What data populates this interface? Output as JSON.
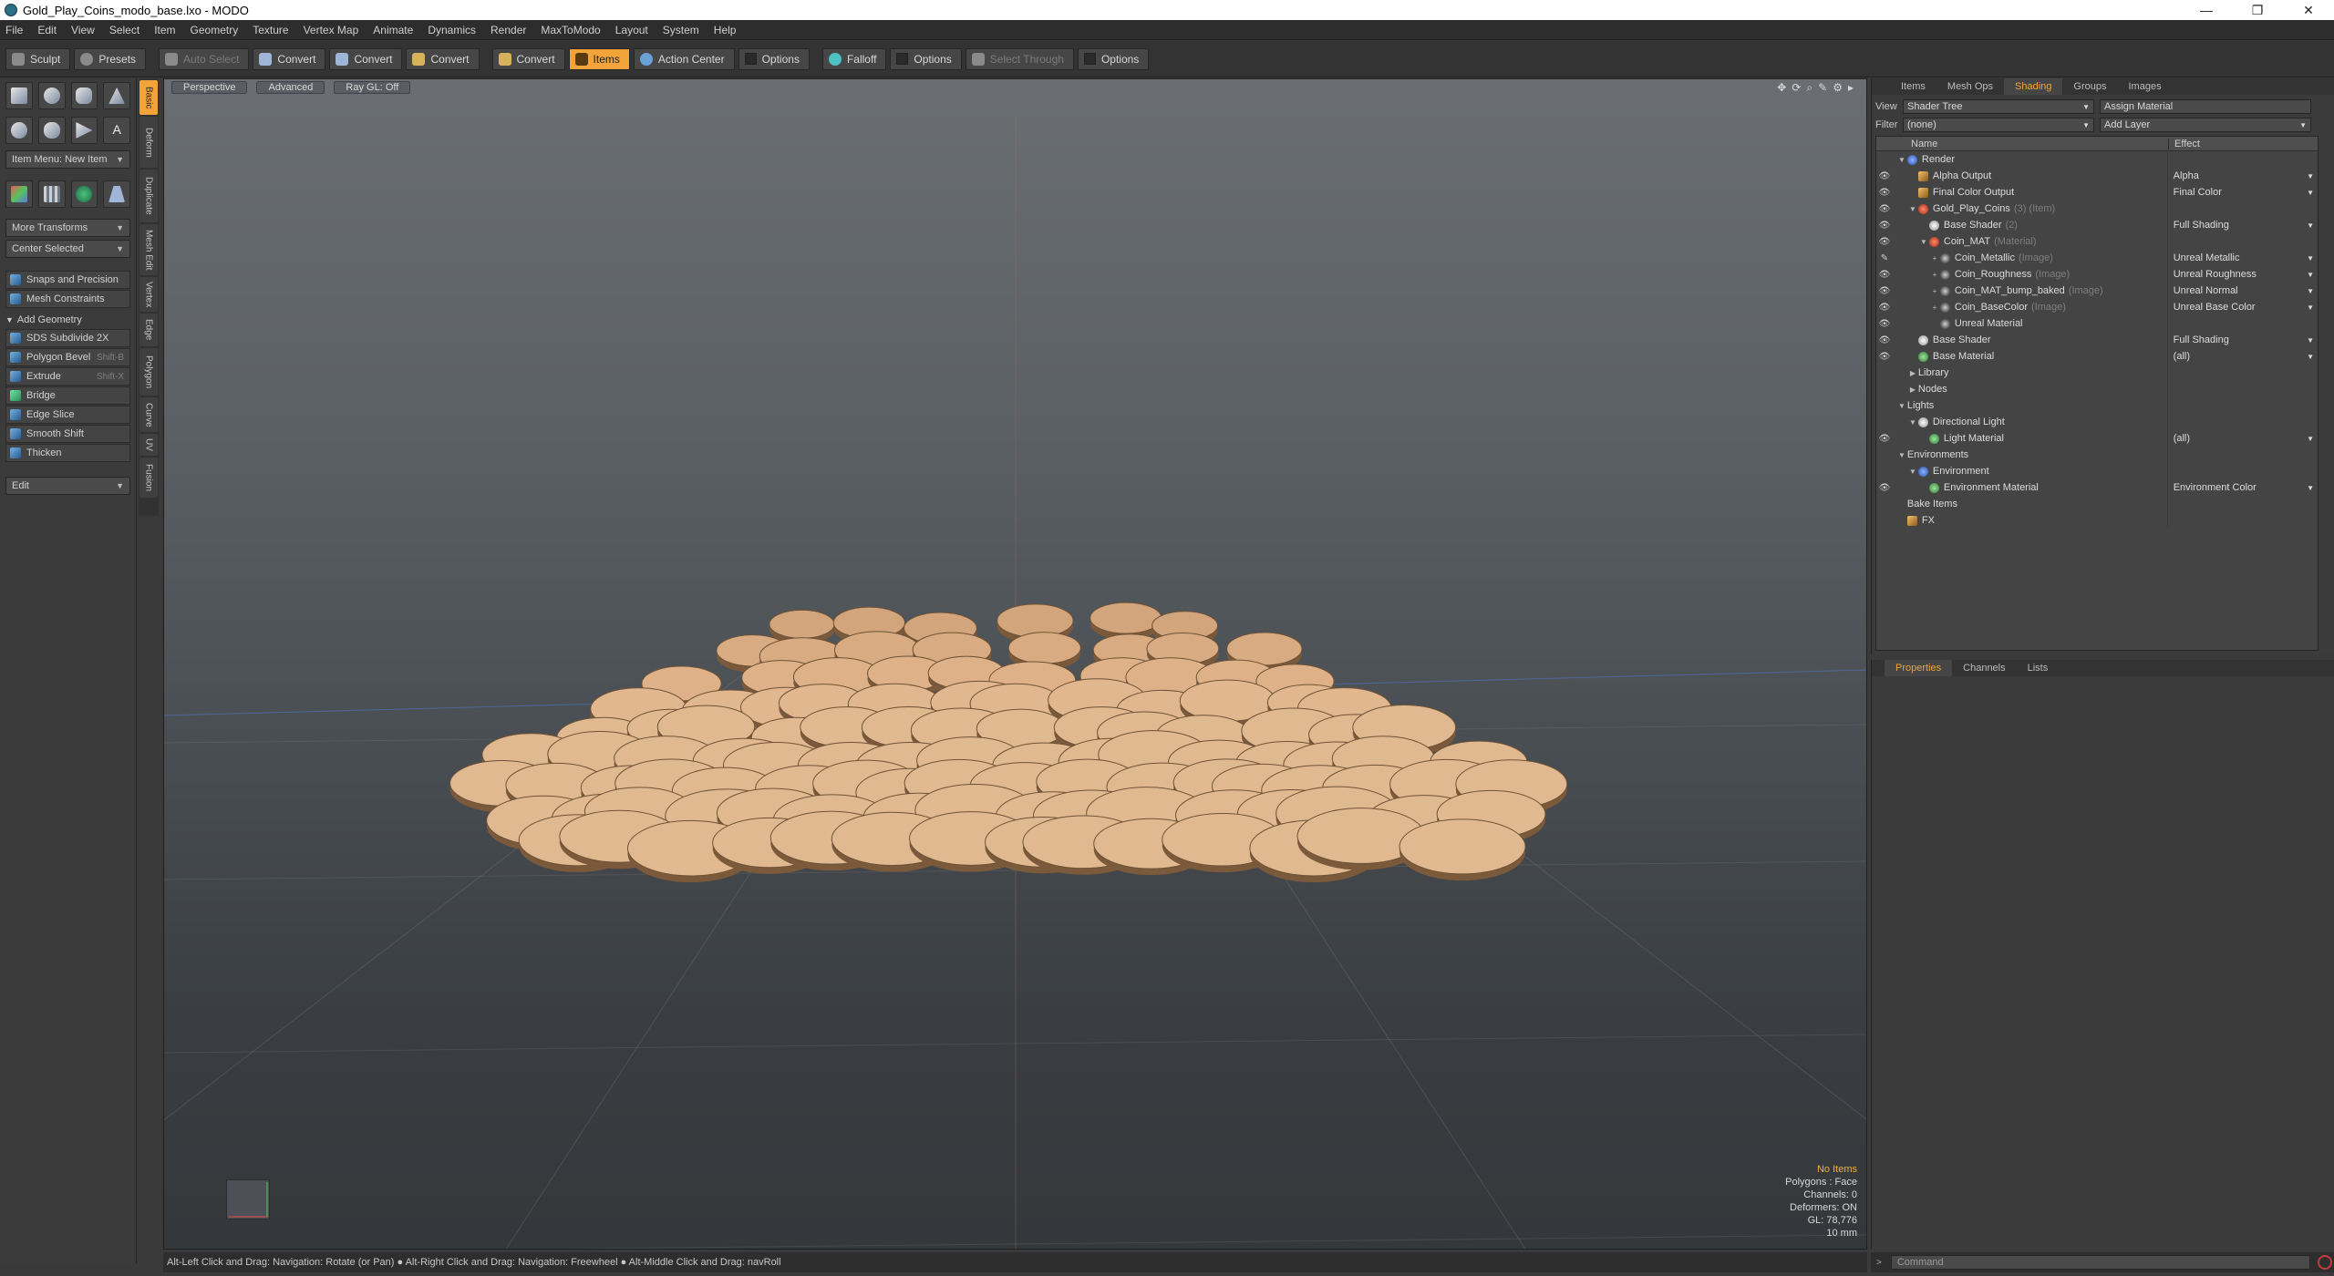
{
  "window": {
    "title": "Gold_Play_Coins_modo_base.lxo - MODO"
  },
  "menu": [
    "File",
    "Edit",
    "View",
    "Select",
    "Item",
    "Geometry",
    "Texture",
    "Vertex Map",
    "Animate",
    "Dynamics",
    "Render",
    "MaxToModo",
    "Layout",
    "System",
    "Help"
  ],
  "toolbar": {
    "sculpt": "Sculpt",
    "presets": "Presets",
    "auto_select": "Auto Select",
    "convert1": "Convert",
    "convert2": "Convert",
    "convert3": "Convert",
    "convert4": "Convert",
    "items": "Items",
    "action_center": "Action Center",
    "options1": "Options",
    "falloff": "Falloff",
    "options2": "Options",
    "select_through": "Select Through",
    "options3": "Options"
  },
  "left": {
    "item_menu": "Item Menu: New Item",
    "more_transforms": "More Transforms",
    "center_selected": "Center Selected",
    "snaps": "Snaps and Precision",
    "mesh_constraints": "Mesh Constraints",
    "add_geometry": "Add Geometry",
    "sds": "SDS Subdivide 2X",
    "polygon_bevel": "Polygon Bevel",
    "polygon_bevel_sc": "Shift-B",
    "extrude": "Extrude",
    "extrude_sc": "Shift-X",
    "bridge": "Bridge",
    "edge_slice": "Edge Slice",
    "smooth_shift": "Smooth Shift",
    "thicken": "Thicken",
    "edit": "Edit"
  },
  "vtabs": [
    "Basic",
    "Deform",
    "Duplicate",
    "Mesh Edit",
    "Vertex",
    "Edge",
    "Polygon",
    "Curve",
    "UV",
    "Fusion"
  ],
  "viewport": {
    "tabs": [
      "Perspective",
      "Advanced",
      "Ray GL: Off"
    ],
    "info": {
      "no_items": "No Items",
      "polygons": "Polygons : Face",
      "channels": "Channels: 0",
      "deformers": "Deformers: ON",
      "gl": "GL: 78,776",
      "scale": "10 mm"
    }
  },
  "status": "Alt-Left Click and Drag: Navigation: Rotate (or Pan) ● Alt-Right Click and Drag: Navigation: Freewheel ● Alt-Middle Click and Drag: navRoll",
  "right": {
    "tabs": [
      "Items",
      "Mesh Ops",
      "Shading",
      "Groups",
      "Images"
    ],
    "view_label": "View",
    "view_value": "Shader Tree",
    "assign_material": "Assign Material",
    "filter_label": "Filter",
    "filter_value": "(none)",
    "add_layer": "Add Layer",
    "col_name": "Name",
    "col_effect": "Effect",
    "tree": [
      {
        "indent": 0,
        "tri": "▼",
        "icon": "blue",
        "name": "Render",
        "tag": "",
        "effect": "",
        "eye": ""
      },
      {
        "indent": 1,
        "tri": "",
        "icon": "sq",
        "name": "Alpha Output",
        "tag": "",
        "effect": "Alpha",
        "eye": "👁"
      },
      {
        "indent": 1,
        "tri": "",
        "icon": "sq",
        "name": "Final Color Output",
        "tag": "",
        "effect": "Final Color",
        "eye": "👁"
      },
      {
        "indent": 1,
        "tri": "▼",
        "icon": "red",
        "name": "Gold_Play_Coins",
        "tag": "(3) (Item)",
        "effect": "",
        "eye": "👁"
      },
      {
        "indent": 2,
        "tri": "",
        "icon": "white",
        "name": "Base Shader",
        "tag": "(2)",
        "effect": "Full Shading",
        "eye": "👁"
      },
      {
        "indent": 2,
        "tri": "▼",
        "icon": "red",
        "name": "Coin_MAT",
        "tag": "(Material)",
        "effect": "",
        "eye": "👁"
      },
      {
        "indent": 3,
        "tri": "+",
        "icon": "dark",
        "name": "Coin_Metallic",
        "tag": "(Image)",
        "effect": "Unreal Metallic",
        "eye": "✎"
      },
      {
        "indent": 3,
        "tri": "+",
        "icon": "dark",
        "name": "Coin_Roughness",
        "tag": "(Image)",
        "effect": "Unreal Roughness",
        "eye": "👁"
      },
      {
        "indent": 3,
        "tri": "+",
        "icon": "dark",
        "name": "Coin_MAT_bump_baked",
        "tag": "(Image)",
        "effect": "Unreal Normal",
        "eye": "👁"
      },
      {
        "indent": 3,
        "tri": "+",
        "icon": "dark",
        "name": "Coin_BaseColor",
        "tag": "(Image)",
        "effect": "Unreal Base Color",
        "eye": "👁"
      },
      {
        "indent": 3,
        "tri": "",
        "icon": "dark",
        "name": "Unreal Material",
        "tag": "",
        "effect": "",
        "eye": "👁"
      },
      {
        "indent": 1,
        "tri": "",
        "icon": "white",
        "name": "Base Shader",
        "tag": "",
        "effect": "Full Shading",
        "eye": "👁"
      },
      {
        "indent": 1,
        "tri": "",
        "icon": "green",
        "name": "Base Material",
        "tag": "",
        "effect": "(all)",
        "eye": "👁"
      },
      {
        "indent": 1,
        "tri": "▶",
        "icon": "",
        "name": "Library",
        "tag": "",
        "effect": "",
        "eye": ""
      },
      {
        "indent": 1,
        "tri": "▶",
        "icon": "",
        "name": "Nodes",
        "tag": "",
        "effect": "",
        "eye": ""
      },
      {
        "indent": 0,
        "tri": "▼",
        "icon": "",
        "name": "Lights",
        "tag": "",
        "effect": "",
        "eye": ""
      },
      {
        "indent": 1,
        "tri": "▼",
        "icon": "white",
        "name": "Directional Light",
        "tag": "",
        "effect": "",
        "eye": ""
      },
      {
        "indent": 2,
        "tri": "",
        "icon": "green",
        "name": "Light Material",
        "tag": "",
        "effect": "(all)",
        "eye": "👁"
      },
      {
        "indent": 0,
        "tri": "▼",
        "icon": "",
        "name": "Environments",
        "tag": "",
        "effect": "",
        "eye": ""
      },
      {
        "indent": 1,
        "tri": "▼",
        "icon": "blue",
        "name": "Environment",
        "tag": "",
        "effect": "",
        "eye": ""
      },
      {
        "indent": 2,
        "tri": "",
        "icon": "green",
        "name": "Environment Material",
        "tag": "",
        "effect": "Environment Color",
        "eye": "👁"
      },
      {
        "indent": 0,
        "tri": "",
        "icon": "",
        "name": "Bake Items",
        "tag": "",
        "effect": "",
        "eye": ""
      },
      {
        "indent": 0,
        "tri": "",
        "icon": "sq",
        "name": "FX",
        "tag": "",
        "effect": "",
        "eye": ""
      }
    ],
    "prop_tabs": [
      "Properties",
      "Channels",
      "Lists"
    ],
    "command_placeholder": "Command"
  }
}
